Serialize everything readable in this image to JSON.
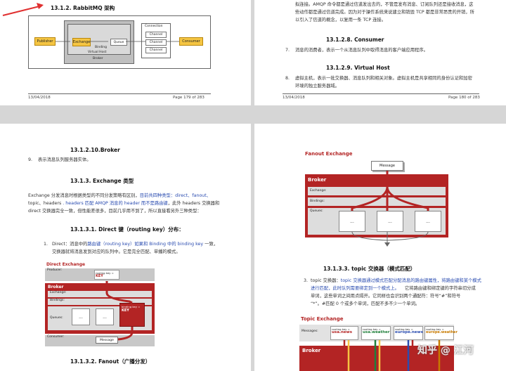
{
  "page1": {
    "heading": "13.1.2.   RabbitMQ 架构",
    "diagram": {
      "publisher": "Publisher",
      "exchange": "Exchange",
      "binding": "Binding",
      "queue": "Queue",
      "virtual_host": "Virtual Host",
      "broker": "Broker",
      "connection": "Connection",
      "channels": [
        "Channel",
        "Channel",
        "Channel"
      ],
      "consumer": "Consumer"
    },
    "footer_date": "13/04/2018",
    "footer_page": "Page 179 of 283"
  },
  "page2": {
    "lines_top": [
      "拟连接。AMQP 命令都是通过信道发出去的，不管是发布消息、订阅队列还是接收消息，这",
      "些动作都是通过信道完成。因为对于操作系统来说建立和销毁 TCP 都是非常昂贵的开销，所",
      "以引入了信道的概念，以复用一条 TCP 连接。"
    ],
    "heading_consumer": "13.1.2.8.   Consumer",
    "item7_num": "7.",
    "item7_text": "消息的消费者，表示一个从消息队列中取得消息的客户端应用程序。",
    "heading_vhost": "13.1.2.9.   Virtual Host",
    "item8_num": "8.",
    "item8_lines": [
      "虚拟主机，表示一批交换器、消息队列和相关对象。虚拟主机是共享相同的身份认证和加密",
      "环境的独立服务器域。"
    ],
    "footer_date": "13/04/2018",
    "footer_page": "Page 180 of 283"
  },
  "page3": {
    "heading_broker": "13.1.2.10.Broker",
    "item9_num": "9.",
    "item9_text": "表示消息队列服务器实体。",
    "heading_exchange_types": "13.1.3.      Exchange 类型",
    "para_lines": [
      [
        "Exchange 分发消息时根据类型的不同分发策略有区别，",
        "目前共四种类型：direct、fanout、",
        ""
      ],
      [
        "topic、headers ",
        ". headers 匹配 AMQP 消息的 header 而不是路由键",
        "，此外 headers 交换器和"
      ],
      [
        "direct 交换器完全一致，但性能差很多，目前几乎用不到了，所以直接看另外三种类型：",
        "",
        ""
      ]
    ],
    "heading_direct": "13.1.3.1.   Direct 键（routing key）分布：",
    "item1_num": "1.",
    "item1_line1_a": "Direct：消息中的",
    "item1_line1_b": "路由键（routing key）如果和 Binding 中的 binding key",
    "item1_line1_c": " 一致，",
    "item1_line2": "交换器就将消息发到对应的队列中。它是完全匹配、单播的模式。",
    "direct_diagram": {
      "title": "Direct Exchange",
      "producer": "Producer:",
      "routing_key_label": "routing key =",
      "routing_key_value": "KEY",
      "broker": "Broker",
      "exchange": "Exchange:",
      "bindings": "Bindings:",
      "binding_key_label": "binding key =",
      "binding_key_value": "KEY",
      "queues": "Queues:",
      "consumer": "Consumer:",
      "message": "Message",
      "dots": "..."
    },
    "heading_fanout": "13.1.3.2.   Fanout（广播分发）"
  },
  "page4": {
    "fanout_diagram": {
      "title": "Fanout Exchange",
      "message": "Message",
      "broker": "Broker",
      "exchange": "Exchange:",
      "bindings": "Bindings:",
      "queues": "Queues:",
      "dots": "..."
    },
    "heading_topic": "13.1.3.3.      topic 交换器（模式匹配）",
    "item3_num": "3.",
    "item3_lines": [
      [
        "topic 交换器：",
        "topic 交换器通过模式匹配分配消息的路由键属性，将路由键和某个模式"
      ],
      [
        "",
        "进行匹配，此时队列需要绑定到一个模式上。"
      ],
      [
        "",
        "它将路由键和绑定键的字符串切分成"
      ],
      [
        "",
        "单词，这些单词之间用点隔开。它同样也会识别两个通配符：符号“#”和符号"
      ],
      [
        "",
        "“*”。#匹配 0 个或多个单词，匹配不多不少一个单词。"
      ]
    ],
    "topic_diagram": {
      "title": "Topic Exchange",
      "messages": "Messages:",
      "routing_key_label": "routing key =",
      "keys": [
        "usa.news",
        "usa.weather",
        "europe.news",
        "europe.weather"
      ],
      "broker": "Broker"
    },
    "watermark": "知乎 @ 江河"
  }
}
